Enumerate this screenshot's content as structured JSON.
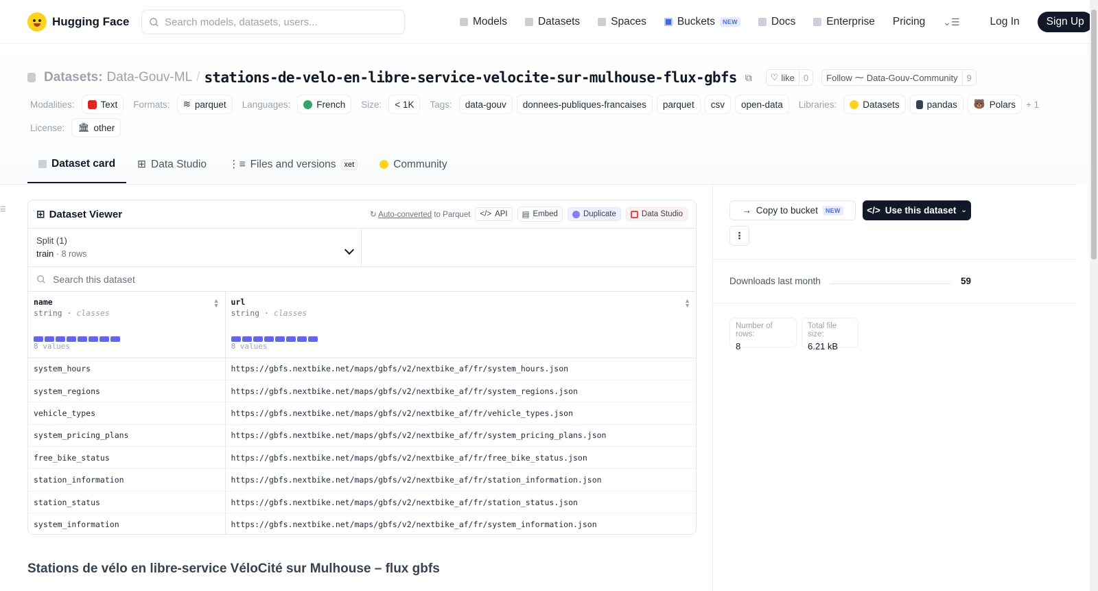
{
  "nav": {
    "brand": "Hugging Face",
    "search_placeholder": "Search models, datasets, users...",
    "links": [
      "Models",
      "Datasets",
      "Spaces",
      "Buckets",
      "Docs",
      "Enterprise",
      "Pricing"
    ],
    "new_badge": "NEW",
    "login": "Log In",
    "signup": "Sign Up"
  },
  "header": {
    "type_label": "Datasets:",
    "owner": "Data-Gouv-ML",
    "repo": "stations-de-velo-en-libre-service-velocite-sur-mulhouse-flux-gbfs",
    "like_label": "like",
    "like_count": "0",
    "follow_label": "Follow",
    "org": "Data-Gouv-Community",
    "follow_count": "9"
  },
  "meta": {
    "modalities_label": "Modalities:",
    "modality": "Text",
    "formats_label": "Formats:",
    "format": "parquet",
    "languages_label": "Languages:",
    "language": "French",
    "size_label": "Size:",
    "size": "< 1K",
    "tags_label": "Tags:",
    "tags": [
      "data-gouv",
      "donnees-publiques-francaises",
      "parquet",
      "csv",
      "open-data"
    ],
    "libraries_label": "Libraries:",
    "libraries": [
      "Datasets",
      "pandas",
      "Polars"
    ],
    "libraries_more": "+ 1",
    "license_label": "License:",
    "license": "other"
  },
  "tabs": {
    "dataset_card": "Dataset card",
    "data_studio": "Data Studio",
    "files": "Files and versions",
    "xet": "xet",
    "community": "Community"
  },
  "viewer": {
    "title": "Dataset Viewer",
    "auto_link": "Auto-converted",
    "auto_rest": "to Parquet",
    "api": "API",
    "embed": "Embed",
    "duplicate": "Duplicate",
    "data_studio": "Data Studio",
    "split_label": "Split (1)",
    "split_name": "train",
    "split_rows": "8 rows",
    "search_placeholder": "Search this dataset",
    "columns": [
      {
        "name": "name",
        "type": "string",
        "kind": "classes",
        "values": "8 values"
      },
      {
        "name": "url",
        "type": "string",
        "kind": "classes",
        "values": "8 values"
      }
    ],
    "rows": [
      [
        "system_hours",
        "https://gbfs.nextbike.net/maps/gbfs/v2/nextbike_af/fr/system_hours.json"
      ],
      [
        "system_regions",
        "https://gbfs.nextbike.net/maps/gbfs/v2/nextbike_af/fr/system_regions.json"
      ],
      [
        "vehicle_types",
        "https://gbfs.nextbike.net/maps/gbfs/v2/nextbike_af/fr/vehicle_types.json"
      ],
      [
        "system_pricing_plans",
        "https://gbfs.nextbike.net/maps/gbfs/v2/nextbike_af/fr/system_pricing_plans.json"
      ],
      [
        "free_bike_status",
        "https://gbfs.nextbike.net/maps/gbfs/v2/nextbike_af/fr/free_bike_status.json"
      ],
      [
        "station_information",
        "https://gbfs.nextbike.net/maps/gbfs/v2/nextbike_af/fr/station_information.json"
      ],
      [
        "station_status",
        "https://gbfs.nextbike.net/maps/gbfs/v2/nextbike_af/fr/station_status.json"
      ],
      [
        "system_information",
        "https://gbfs.nextbike.net/maps/gbfs/v2/nextbike_af/fr/system_information.json"
      ]
    ]
  },
  "card": {
    "title": "Stations de vélo en libre-service VéloCité sur Mulhouse – flux gbfs"
  },
  "sidebar": {
    "copy_bucket": "Copy to bucket",
    "use_dataset": "Use this dataset",
    "more": "⋮",
    "downloads_label": "Downloads last month",
    "downloads_value": "59",
    "rows_label": "Number of rows:",
    "rows_value": "8",
    "filesize_label": "Total file size:",
    "filesize_value": "6.21 kB"
  },
  "colors": {
    "accent": "#6366f1",
    "brand_yellow": "#ffd21e",
    "dark": "#111827"
  }
}
